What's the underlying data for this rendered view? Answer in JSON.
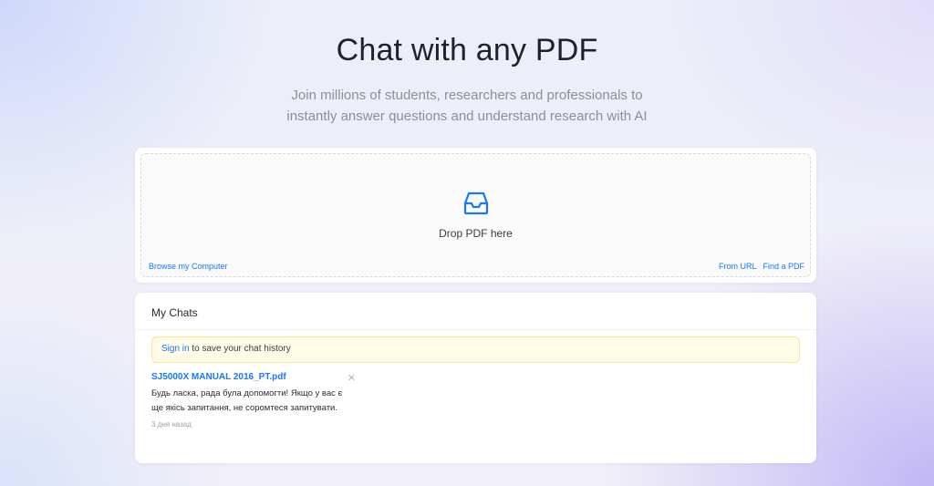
{
  "hero": {
    "title": "Chat with any PDF",
    "subtitle_line1": "Join millions of students, researchers and professionals to",
    "subtitle_line2": "instantly answer questions and understand research with AI"
  },
  "upload": {
    "icon": "inbox-icon",
    "drop_text": "Drop PDF here",
    "browse_label": "Browse my Computer",
    "from_url_label": "From URL",
    "find_pdf_label": "Find a PDF",
    "accent_color": "#1677ff"
  },
  "chats": {
    "heading": "My Chats",
    "signin_notice": {
      "link_label": "Sign in",
      "text": " to save your chat history"
    },
    "items": [
      {
        "title": "SJ5000X MANUAL 2016_PT.pdf",
        "close_icon": "close-icon",
        "message": "Будь ласка, рада була допомогти! Якщо у вас є ще якісь запитання, не соромтеся запитувати.",
        "time": "3 дня назад"
      }
    ]
  }
}
